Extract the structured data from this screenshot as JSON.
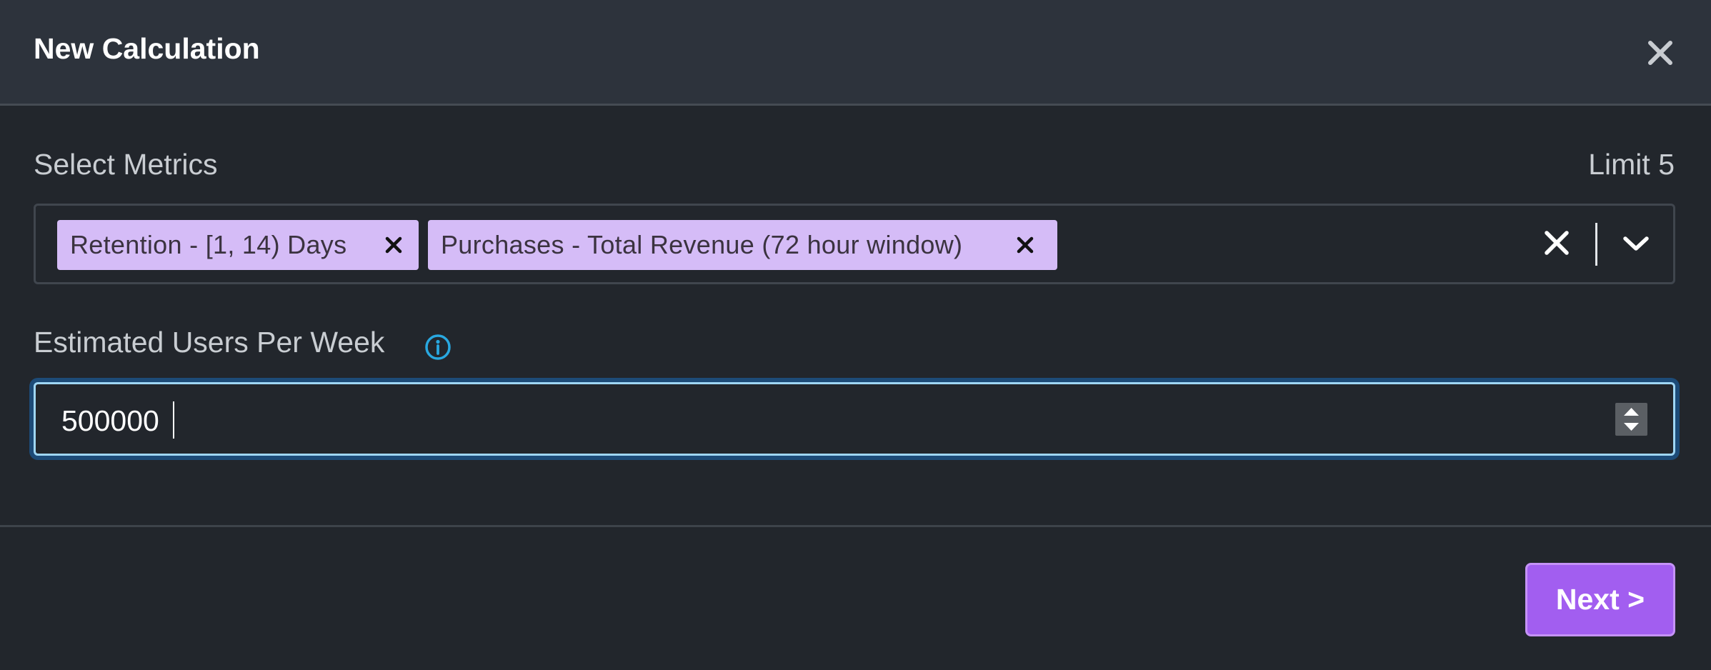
{
  "modal": {
    "title": "New Calculation"
  },
  "metrics": {
    "label": "Select Metrics",
    "limit_label": "Limit 5",
    "selected": [
      {
        "label": "Retention - [1, 14) Days"
      },
      {
        "label": "Purchases - Total Revenue (72 hour window)"
      }
    ],
    "chip_color": "#d5bcf7"
  },
  "users": {
    "label": "Estimated Users Per Week",
    "value": "500000"
  },
  "footer": {
    "next_label": "Next >"
  },
  "colors": {
    "accent": "#a25ef0",
    "focus_border": "#9fd6f5",
    "info": "#29a8e0"
  },
  "icons": {
    "close": "close-icon",
    "chip_remove": "close-icon",
    "clear": "close-icon",
    "dropdown": "chevron-down-icon",
    "info": "info-icon",
    "spinner": "spinner-arrows-icon"
  }
}
